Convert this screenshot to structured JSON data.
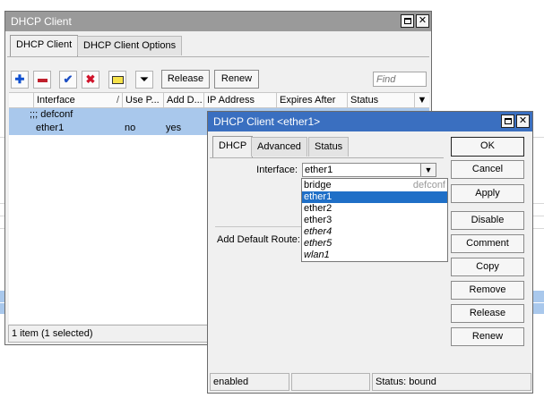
{
  "colors": {
    "active_title": "#3a6fc0",
    "inactive_title": "#9a9a9a",
    "selection": "#a9c8ec",
    "dropdown_highlight": "#1f6fc7"
  },
  "client_window": {
    "title": "DHCP Client",
    "tabs": [
      "DHCP Client",
      "DHCP Client Options"
    ],
    "toolbar": {
      "add_icon": "plus-icon",
      "remove_icon": "minus-icon",
      "enable_icon": "check-icon",
      "disable_icon": "x-icon",
      "comment_icon": "note-icon",
      "filter_icon": "filter-icon",
      "release_label": "Release",
      "renew_label": "Renew",
      "find_placeholder": "Find"
    },
    "columns": [
      "Interface",
      "Use P...",
      "Add D...",
      "IP Address",
      "Expires After",
      "Status"
    ],
    "group_label": ";;; defconf",
    "rows": [
      {
        "interface": "ether1",
        "use_peer": "no",
        "add_default": "yes",
        "ip_address": "",
        "expires_after": "",
        "status": ""
      }
    ],
    "status_text": "1 item (1 selected)"
  },
  "edit_window": {
    "title": "DHCP Client <ether1>",
    "tabs": [
      "DHCP",
      "Advanced",
      "Status"
    ],
    "interface_label": "Interface:",
    "interface_value": "ether1",
    "default_route_label": "Add Default Route:",
    "dropdown": {
      "items": [
        {
          "name": "bridge",
          "comment": "defconf",
          "italic": false,
          "selected": false
        },
        {
          "name": "ether1",
          "comment": "",
          "italic": false,
          "selected": true
        },
        {
          "name": "ether2",
          "comment": "",
          "italic": false,
          "selected": false
        },
        {
          "name": "ether3",
          "comment": "",
          "italic": false,
          "selected": false
        },
        {
          "name": "ether4",
          "comment": "",
          "italic": true,
          "selected": false
        },
        {
          "name": "ether5",
          "comment": "",
          "italic": true,
          "selected": false
        },
        {
          "name": "wlan1",
          "comment": "",
          "italic": true,
          "selected": false
        }
      ]
    },
    "buttons": [
      "OK",
      "Cancel",
      "Apply",
      "Disable",
      "Comment",
      "Copy",
      "Remove",
      "Release",
      "Renew"
    ],
    "status_bar": {
      "left": "enabled",
      "middle": "",
      "right": "Status: bound"
    }
  }
}
